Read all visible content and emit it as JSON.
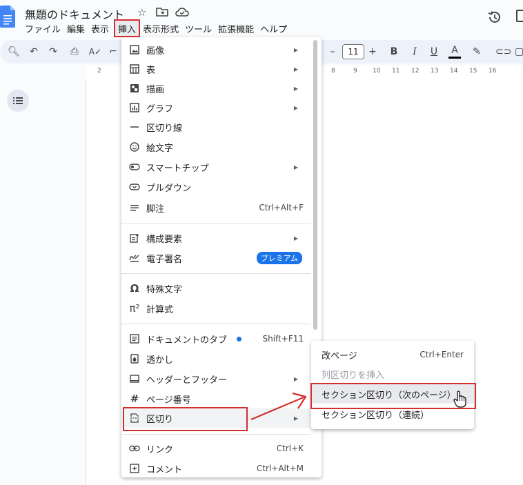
{
  "header": {
    "title": "無題のドキュメント",
    "menus": [
      "ファイル",
      "編集",
      "表示",
      "挿入",
      "表示形式",
      "ツール",
      "拡張機能",
      "ヘルプ"
    ],
    "active_menu_index": 3
  },
  "toolbar": {
    "font_size": "11",
    "bold": "B",
    "italic": "I",
    "underline": "U",
    "text_color": "A",
    "minus": "–",
    "plus": "+"
  },
  "ruler": {
    "left_numbers": [
      "2"
    ],
    "right_numbers": [
      "8",
      "9",
      "10",
      "11",
      "12",
      "13",
      "14",
      "15",
      "16"
    ]
  },
  "insert_menu": {
    "items": [
      {
        "label": "画像",
        "icon": "image-icon"
      },
      {
        "label": "表",
        "icon": "table-icon"
      },
      {
        "label": "描画",
        "icon": "drawing-icon"
      },
      {
        "label": "グラフ",
        "icon": "chart-icon"
      },
      {
        "label": "区切り線",
        "icon": "horizontal-line-icon"
      },
      {
        "label": "絵文字",
        "icon": "emoji-icon"
      },
      {
        "label": "スマートチップ",
        "icon": "smart-chip-icon"
      },
      {
        "label": "プルダウン",
        "icon": "dropdown-icon"
      },
      {
        "label": "脚注",
        "icon": "footnote-icon",
        "shortcut": "Ctrl+Alt+F"
      },
      {
        "label": "構成要素",
        "icon": "building-blocks-icon"
      },
      {
        "label": "電子署名",
        "icon": "signature-icon",
        "badge": "プレミアム"
      },
      {
        "label": "特殊文字",
        "icon": "omega-icon"
      },
      {
        "label": "計算式",
        "icon": "pi-icon"
      },
      {
        "label": "ドキュメントのタブ",
        "icon": "tab-icon",
        "shortcut": "Shift+F11"
      },
      {
        "label": "透かし",
        "icon": "watermark-icon"
      },
      {
        "label": "ヘッダーとフッター",
        "icon": "header-footer-icon"
      },
      {
        "label": "ページ番号",
        "icon": "hash-icon"
      },
      {
        "label": "区切り",
        "icon": "break-icon"
      },
      {
        "label": "リンク",
        "icon": "link-icon",
        "shortcut": "Ctrl+K"
      },
      {
        "label": "コメント",
        "icon": "comment-icon",
        "shortcut": "Ctrl+Alt+M"
      }
    ]
  },
  "break_submenu": {
    "items": [
      {
        "label": "改ページ",
        "shortcut": "Ctrl+Enter"
      },
      {
        "label": "列区切りを挿入",
        "disabled": true
      },
      {
        "label": "セクション区切り（次のページ）"
      },
      {
        "label": "セクション区切り（連続）"
      }
    ]
  },
  "colors": {
    "accent": "#1a73e8",
    "highlight_box": "#d32f2f",
    "arrow": "#d32f2f"
  }
}
